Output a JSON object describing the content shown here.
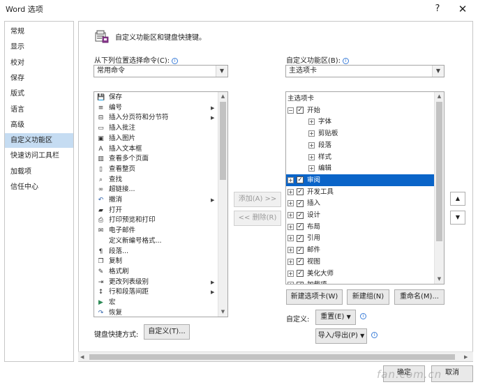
{
  "window": {
    "title": "Word 选项",
    "help": "?",
    "close": "✕"
  },
  "nav": {
    "items": [
      "常规",
      "显示",
      "校对",
      "保存",
      "版式",
      "语言",
      "高级",
      "自定义功能区",
      "快速访问工具栏",
      "加载项",
      "信任中心"
    ],
    "selected_index": 7
  },
  "header": {
    "text": "自定义功能区和键盘快捷键。"
  },
  "left": {
    "label": "从下列位置选择命令(C):",
    "combo_value": "常用命令",
    "commands": [
      {
        "icon": "save-icon",
        "label": "保存"
      },
      {
        "icon": "numbering-icon",
        "label": "编号",
        "submenu": true
      },
      {
        "icon": "section-break-icon",
        "label": "插入分页符和分节符",
        "submenu": true
      },
      {
        "icon": "comment-icon",
        "label": "插入批注"
      },
      {
        "icon": "picture-icon",
        "label": "插入图片"
      },
      {
        "icon": "textbox-icon",
        "label": "插入文本框"
      },
      {
        "icon": "multipage-icon",
        "label": "查看多个页面"
      },
      {
        "icon": "fullpage-icon",
        "label": "查看整页"
      },
      {
        "icon": "find-icon",
        "label": "查找"
      },
      {
        "icon": "hyperlink-icon",
        "label": "超链接..."
      },
      {
        "icon": "undo-icon",
        "label": "撤消",
        "submenu": true
      },
      {
        "icon": "open-icon",
        "label": "打开"
      },
      {
        "icon": "print-preview-icon",
        "label": "打印预览和打印"
      },
      {
        "icon": "email-icon",
        "label": "电子邮件"
      },
      {
        "icon": "blank-icon",
        "label": "定义新编号格式..."
      },
      {
        "icon": "paragraph-icon",
        "label": "段落..."
      },
      {
        "icon": "copy-icon",
        "label": "复制"
      },
      {
        "icon": "format-painter-icon",
        "label": "格式刷"
      },
      {
        "icon": "list-level-icon",
        "label": "更改列表级别",
        "submenu": true
      },
      {
        "icon": "line-spacing-icon",
        "label": "行和段落间距",
        "submenu": true
      },
      {
        "icon": "macro-icon",
        "label": "宏"
      },
      {
        "icon": "redo-icon",
        "label": "恢复"
      }
    ]
  },
  "middle": {
    "add": "添加(A) >>",
    "remove": "<< 删除(R)"
  },
  "right": {
    "label": "自定义功能区(B):",
    "combo_value": "主选项卡",
    "tree": [
      {
        "label": "主选项卡",
        "level": 0,
        "header": true
      },
      {
        "label": "开始",
        "level": 1,
        "expander": "⊟",
        "checked": true
      },
      {
        "label": "字体",
        "level": 2,
        "expander": "⊞"
      },
      {
        "label": "剪贴板",
        "level": 2,
        "expander": "⊞"
      },
      {
        "label": "段落",
        "level": 2,
        "expander": "⊞"
      },
      {
        "label": "样式",
        "level": 2,
        "expander": "⊞"
      },
      {
        "label": "编辑",
        "level": 2,
        "expander": "⊞"
      },
      {
        "label": "审阅",
        "level": 1,
        "expander": "⊞",
        "checked": true,
        "selected": true
      },
      {
        "label": "开发工具",
        "level": 1,
        "expander": "⊞",
        "checked": true
      },
      {
        "label": "插入",
        "level": 1,
        "expander": "⊞",
        "checked": true
      },
      {
        "label": "设计",
        "level": 1,
        "expander": "⊞",
        "checked": true
      },
      {
        "label": "布局",
        "level": 1,
        "expander": "⊞",
        "checked": true
      },
      {
        "label": "引用",
        "level": 1,
        "expander": "⊞",
        "checked": true
      },
      {
        "label": "邮件",
        "level": 1,
        "expander": "⊞",
        "checked": true
      },
      {
        "label": "视图",
        "level": 1,
        "expander": "⊞",
        "checked": true
      },
      {
        "label": "美化大师",
        "level": 1,
        "expander": "⊞",
        "checked": true
      },
      {
        "label": "加载项",
        "level": 1,
        "expander": "⊞",
        "checked": true
      }
    ],
    "new_tab": "新建选项卡(W)",
    "new_group": "新建组(N)",
    "rename": "重命名(M)...",
    "customize_label": "自定义:",
    "reset": "重置(E)",
    "import_export": "导入/导出(P)",
    "move_up": "▲",
    "move_down": "▼"
  },
  "shortcut": {
    "label": "键盘快捷方式:",
    "button": "自定义(T)..."
  },
  "footer": {
    "ok": "确定",
    "cancel": "取消",
    "watermark": "fan.com.cn"
  },
  "colors": {
    "selected_nav": "#c5dcf2",
    "selected_tree": "#0a64c8"
  }
}
